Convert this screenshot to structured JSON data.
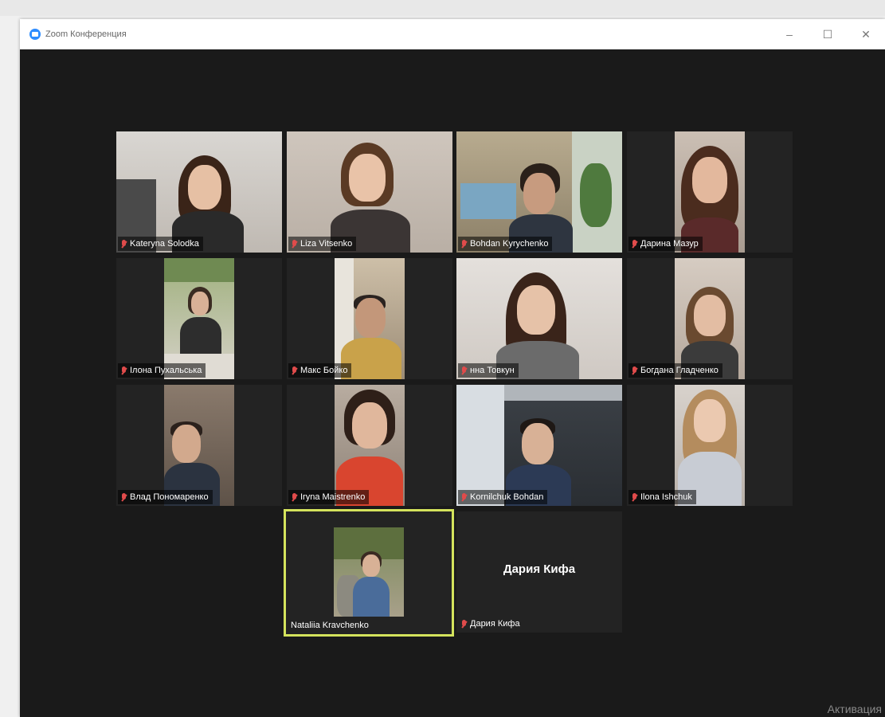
{
  "window": {
    "title": "Zoom Конференция",
    "min": "–",
    "max": "☐",
    "close": "✕"
  },
  "participants": [
    {
      "name": "Kateryna Solodka"
    },
    {
      "name": "Liza Vitsenko"
    },
    {
      "name": "Bohdan Kyrychenko"
    },
    {
      "name": "Дарина Мазур"
    },
    {
      "name": "Ілона Пухальська"
    },
    {
      "name": "Макс Бойко"
    },
    {
      "name": "нна Товкун"
    },
    {
      "name": "Богдана Гладченко"
    },
    {
      "name": "Влад Пономаренко"
    },
    {
      "name": "Iryna Maistrenko"
    },
    {
      "name": "Kornilchuk Bohdan"
    },
    {
      "name": "Ilona Ishchuk"
    },
    {
      "name": "Nataliia Kravchenko"
    },
    {
      "name": "Дария Кифа",
      "display": "Дария Кифа"
    }
  ],
  "watermark": "Активация",
  "colors": {
    "active_border": "#d4e35c",
    "stage": "#1a1a1a",
    "muted": "#e04b4b"
  }
}
